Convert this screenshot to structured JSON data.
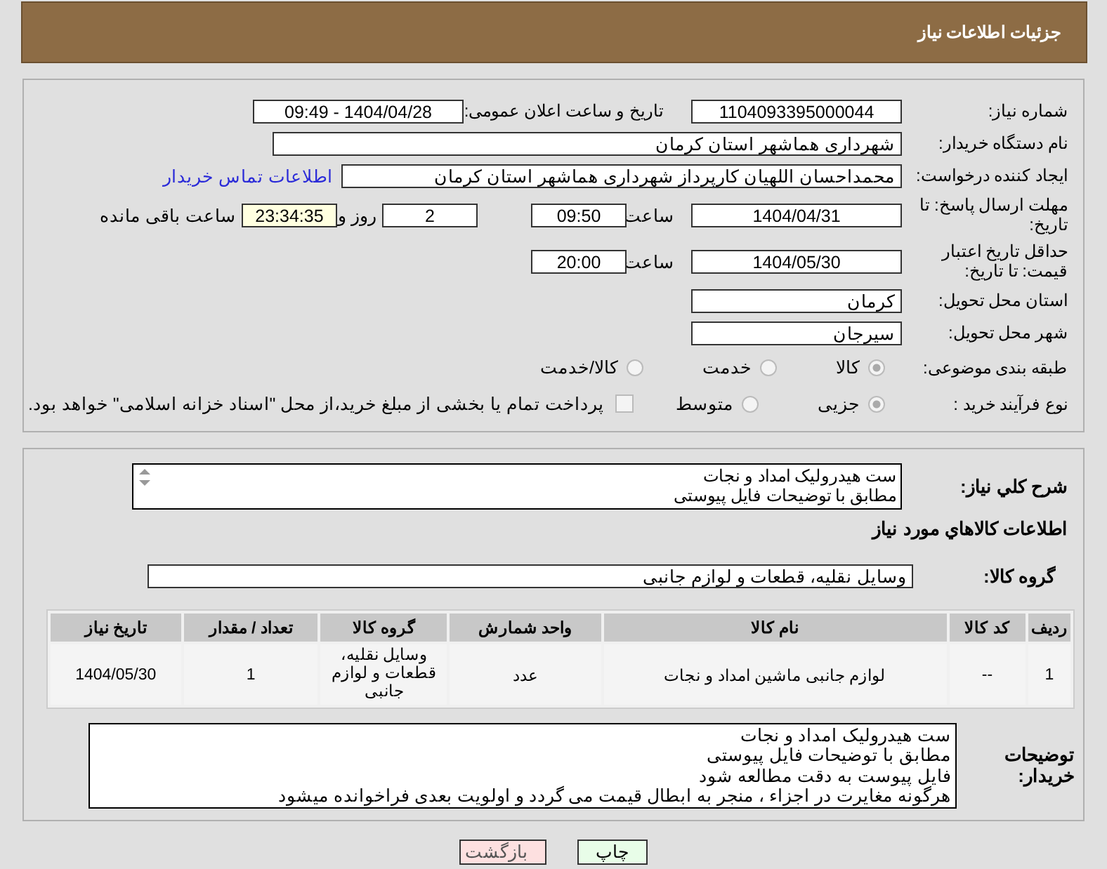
{
  "header": {
    "title": "جزئیات اطلاعات نیاز"
  },
  "need_number": {
    "label": "شماره نیاز:",
    "value": "1104093395000044"
  },
  "announce": {
    "label": "تاریخ و ساعت اعلان عمومی:",
    "value": "1404/04/28 - 09:49"
  },
  "buyer_org": {
    "label": "نام دستگاه خریدار:",
    "value": "شهرداری هماشهر استان کرمان"
  },
  "creator": {
    "label": "ایجاد کننده درخواست:",
    "value": "محمداحسان اللهیان کارپرداز  شهرداری هماشهر استان کرمان",
    "link": "اطلاعات تماس خریدار"
  },
  "deadline": {
    "label": "مهلت ارسال پاسخ: تا تاریخ:",
    "date": "1404/04/31",
    "time_label": "ساعت",
    "time": "09:50",
    "days": "2",
    "days_label": "روز و",
    "remaining": "23:34:35",
    "remaining_label": "ساعت باقی مانده"
  },
  "validity": {
    "label": "حداقل تاریخ اعتبار قیمت: تا تاریخ:",
    "date": "1404/05/30",
    "time_label": "ساعت",
    "time": "20:00"
  },
  "province": {
    "label": "استان محل تحویل:",
    "value": "کرمان"
  },
  "city": {
    "label": "شهر محل تحویل:",
    "value": "سیرجان"
  },
  "category": {
    "label": "طبقه بندی موضوعی:",
    "options": [
      {
        "label": "کالا",
        "selected": true
      },
      {
        "label": "خدمت",
        "selected": false
      },
      {
        "label": "کالا/خدمت",
        "selected": false
      }
    ]
  },
  "process": {
    "label": "نوع فرآیند خرید :",
    "options": [
      {
        "label": "جزیی",
        "selected": true
      },
      {
        "label": "متوسط",
        "selected": false
      }
    ],
    "treasury": {
      "label": "پرداخت تمام یا بخشی از مبلغ خرید،از محل \"اسناد خزانه اسلامی\" خواهد بود.",
      "checked": false
    }
  },
  "summary": {
    "label": "شرح کلي نياز:",
    "lines": [
      "ست هیدرولیک امداد و نجات",
      "مطابق با توضیحات فایل پیوستی"
    ]
  },
  "goods_heading": "اطلاعات کالاهاي مورد نياز",
  "goods_group": {
    "label": "گروه کالا:",
    "value": "وسایل نقلیه، قطعات و لوازم جانبی"
  },
  "table": {
    "columns": [
      "ردیف",
      "کد کالا",
      "نام کالا",
      "واحد شمارش",
      "گروه کالا",
      "تعداد / مقدار",
      "تاریخ نیاز"
    ],
    "rows": [
      [
        "1",
        "--",
        "لوازم جانبی ماشین امداد و نجات",
        "عدد",
        "وسایل نقلیه، قطعات و لوازم جانبی",
        "1",
        "1404/05/30"
      ]
    ]
  },
  "buyer_notes": {
    "label": "توضیحات خریدار:",
    "lines": [
      "ست هیدرولیک امداد و نجات",
      "مطابق با توضیحات فایل پیوستی",
      "فایل پیوست به دقت مطالعه شود",
      "هرگونه مغایرت در اجزاء ، منجر به ابطال قیمت می گردد و اولویت بعدی فراخوانده میشود"
    ]
  },
  "buttons": [
    {
      "kind": "print",
      "label": "چاپ"
    },
    {
      "kind": "back",
      "label": "بازگشت"
    }
  ]
}
